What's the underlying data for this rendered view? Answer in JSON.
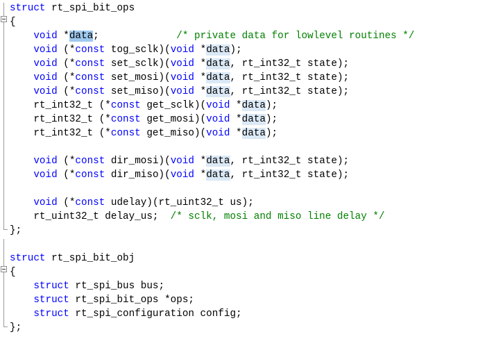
{
  "editor": {
    "lines": [
      [
        {
          "t": "struct",
          "c": "kw"
        },
        {
          "t": " rt_spi_bit_ops"
        }
      ],
      [
        {
          "t": "{"
        }
      ],
      [
        {
          "t": "    "
        },
        {
          "t": "void",
          "c": "kw"
        },
        {
          "t": " *"
        },
        {
          "t": "data",
          "c": "hl-sel"
        },
        {
          "t": ";             "
        },
        {
          "t": "/* private data for lowlevel routines */",
          "c": "cm"
        }
      ],
      [
        {
          "t": "    "
        },
        {
          "t": "void",
          "c": "kw"
        },
        {
          "t": " (*"
        },
        {
          "t": "const",
          "c": "kw"
        },
        {
          "t": " tog_sclk)("
        },
        {
          "t": "void",
          "c": "kw"
        },
        {
          "t": " *"
        },
        {
          "t": "data",
          "c": "hl-ref"
        },
        {
          "t": ");"
        }
      ],
      [
        {
          "t": "    "
        },
        {
          "t": "void",
          "c": "kw"
        },
        {
          "t": " (*"
        },
        {
          "t": "const",
          "c": "kw"
        },
        {
          "t": " set_sclk)("
        },
        {
          "t": "void",
          "c": "kw"
        },
        {
          "t": " *"
        },
        {
          "t": "data",
          "c": "hl-ref"
        },
        {
          "t": ", rt_int32_t state);"
        }
      ],
      [
        {
          "t": "    "
        },
        {
          "t": "void",
          "c": "kw"
        },
        {
          "t": " (*"
        },
        {
          "t": "const",
          "c": "kw"
        },
        {
          "t": " set_mosi)("
        },
        {
          "t": "void",
          "c": "kw"
        },
        {
          "t": " *"
        },
        {
          "t": "data",
          "c": "hl-ref"
        },
        {
          "t": ", rt_int32_t state);"
        }
      ],
      [
        {
          "t": "    "
        },
        {
          "t": "void",
          "c": "kw"
        },
        {
          "t": " (*"
        },
        {
          "t": "const",
          "c": "kw"
        },
        {
          "t": " set_miso)("
        },
        {
          "t": "void",
          "c": "kw"
        },
        {
          "t": " *"
        },
        {
          "t": "data",
          "c": "hl-ref"
        },
        {
          "t": ", rt_int32_t state);"
        }
      ],
      [
        {
          "t": "    rt_int32_t (*"
        },
        {
          "t": "const",
          "c": "kw"
        },
        {
          "t": " get_sclk)("
        },
        {
          "t": "void",
          "c": "kw"
        },
        {
          "t": " *"
        },
        {
          "t": "data",
          "c": "hl-ref"
        },
        {
          "t": ");"
        }
      ],
      [
        {
          "t": "    rt_int32_t (*"
        },
        {
          "t": "const",
          "c": "kw"
        },
        {
          "t": " get_mosi)("
        },
        {
          "t": "void",
          "c": "kw"
        },
        {
          "t": " *"
        },
        {
          "t": "data",
          "c": "hl-ref"
        },
        {
          "t": ");"
        }
      ],
      [
        {
          "t": "    rt_int32_t (*"
        },
        {
          "t": "const",
          "c": "kw"
        },
        {
          "t": " get_miso)("
        },
        {
          "t": "void",
          "c": "kw"
        },
        {
          "t": " *"
        },
        {
          "t": "data",
          "c": "hl-ref"
        },
        {
          "t": ");"
        }
      ],
      [],
      [
        {
          "t": "    "
        },
        {
          "t": "void",
          "c": "kw"
        },
        {
          "t": " (*"
        },
        {
          "t": "const",
          "c": "kw"
        },
        {
          "t": " dir_mosi)("
        },
        {
          "t": "void",
          "c": "kw"
        },
        {
          "t": " *"
        },
        {
          "t": "data",
          "c": "hl-ref"
        },
        {
          "t": ", rt_int32_t state);"
        }
      ],
      [
        {
          "t": "    "
        },
        {
          "t": "void",
          "c": "kw"
        },
        {
          "t": " (*"
        },
        {
          "t": "const",
          "c": "kw"
        },
        {
          "t": " dir_miso)("
        },
        {
          "t": "void",
          "c": "kw"
        },
        {
          "t": " *"
        },
        {
          "t": "data",
          "c": "hl-ref"
        },
        {
          "t": ", rt_int32_t state);"
        }
      ],
      [],
      [
        {
          "t": "    "
        },
        {
          "t": "void",
          "c": "kw"
        },
        {
          "t": " (*"
        },
        {
          "t": "const",
          "c": "kw"
        },
        {
          "t": " udelay)(rt_uint32_t us);"
        }
      ],
      [
        {
          "t": "    rt_uint32_t delay_us;  "
        },
        {
          "t": "/* sclk, mosi and miso line delay */",
          "c": "cm"
        }
      ],
      [
        {
          "t": "};"
        }
      ],
      [],
      [
        {
          "t": "struct",
          "c": "kw"
        },
        {
          "t": " rt_spi_bit_obj"
        }
      ],
      [
        {
          "t": "{"
        }
      ],
      [
        {
          "t": "    "
        },
        {
          "t": "struct",
          "c": "kw"
        },
        {
          "t": " rt_spi_bus bus;"
        }
      ],
      [
        {
          "t": "    "
        },
        {
          "t": "struct",
          "c": "kw"
        },
        {
          "t": " rt_spi_bit_ops *ops;"
        }
      ],
      [
        {
          "t": "    "
        },
        {
          "t": "struct",
          "c": "kw"
        },
        {
          "t": " rt_spi_configuration config;"
        }
      ],
      [
        {
          "t": "};"
        }
      ]
    ],
    "colors": {
      "keyword": "#0000ff",
      "comment": "#008000",
      "text": "#000000",
      "selection": "#9fc9ef",
      "reference_highlight": "#dbe9f6",
      "background": "#ffffff"
    }
  }
}
